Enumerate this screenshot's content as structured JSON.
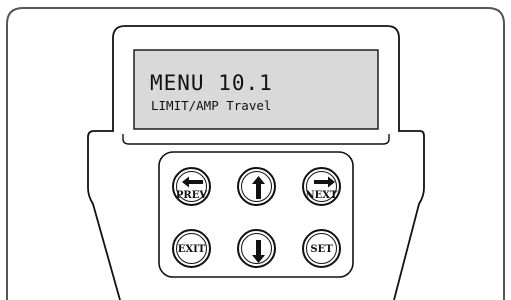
{
  "display": {
    "line1": "MENU 10.1",
    "line2": "LIMIT/AMP Travel"
  },
  "buttons": {
    "prev": "PREV",
    "next": "NEXT",
    "exit": "EXIT",
    "set": "SET"
  },
  "icons": {
    "prev": "arrow-left-icon",
    "up": "arrow-up-icon",
    "next": "arrow-right-icon",
    "down": "arrow-down-icon"
  },
  "colors": {
    "lcd_background": "#d9d9d9",
    "outline": "#111111",
    "panel_border": "#555555"
  }
}
